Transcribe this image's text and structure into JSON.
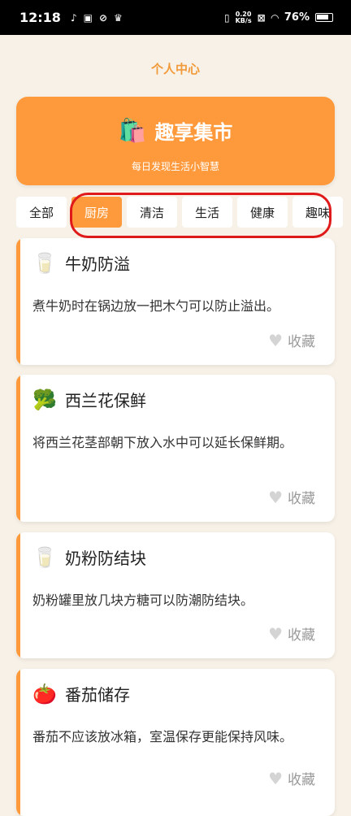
{
  "status": {
    "time": "12:18",
    "speed_top": "0.20",
    "speed_bottom": "KB/s",
    "battery": "76%"
  },
  "page": {
    "title": "个人中心"
  },
  "banner": {
    "icon": "shopping-bag-icon",
    "title": "趣享集市",
    "subtitle": "每日发现生活小智慧"
  },
  "tabs": [
    {
      "label": "全部",
      "active": false
    },
    {
      "label": "厨房",
      "active": true
    },
    {
      "label": "清洁",
      "active": false
    },
    {
      "label": "生活",
      "active": false
    },
    {
      "label": "健康",
      "active": false
    },
    {
      "label": "趣味",
      "active": false
    }
  ],
  "cards": [
    {
      "icon": "milk-icon",
      "emoji": "🥛",
      "title": "牛奶防溢",
      "desc": "煮牛奶时在锅边放一把木勺可以防止溢出。",
      "fav": "收藏"
    },
    {
      "icon": "broccoli-icon",
      "emoji": "🥦",
      "title": "西兰花保鲜",
      "desc": "将西兰花茎部朝下放入水中可以延长保鲜期。",
      "fav": "收藏"
    },
    {
      "icon": "milk-icon",
      "emoji": "🥛",
      "title": "奶粉防结块",
      "desc": "奶粉罐里放几块方糖可以防潮防结块。",
      "fav": "收藏"
    },
    {
      "icon": "tomato-icon",
      "emoji": "🍅",
      "title": "番茄储存",
      "desc": "番茄不应该放冰箱，室温保存更能保持风味。",
      "fav": "收藏"
    }
  ],
  "colors": {
    "accent": "#ff9a3c",
    "title": "#f29a3a",
    "highlight": "#e01a1a",
    "background": "#f7f1e7"
  }
}
